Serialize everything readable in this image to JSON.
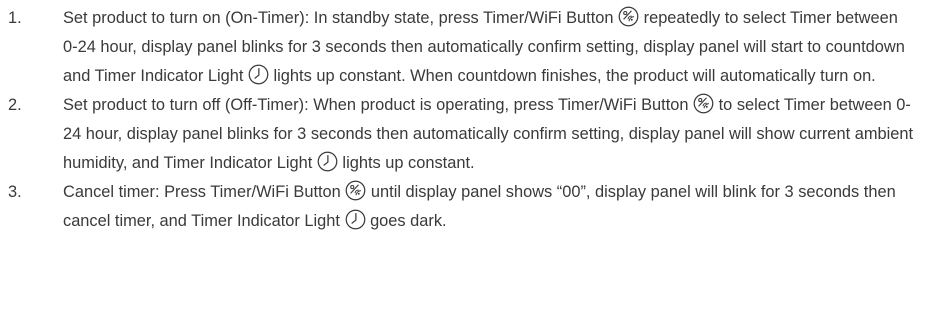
{
  "items": [
    {
      "number": "1.",
      "segments": [
        {
          "type": "text",
          "value": "Set product to turn on (On-Timer): In standby state, press Timer/WiFi Button "
        },
        {
          "type": "icon",
          "icon": "timer-wifi-button-icon"
        },
        {
          "type": "text",
          "value": " repeatedly to select Timer between 0-24 hour, display panel blinks for 3 seconds then automatically confirm setting, display panel will start to countdown and Timer Indicator Light "
        },
        {
          "type": "icon",
          "icon": "timer-indicator-light-icon"
        },
        {
          "type": "text",
          "value": " lights up constant. When countdown finishes, the product will automatically turn on."
        }
      ]
    },
    {
      "number": "2.",
      "segments": [
        {
          "type": "text",
          "value": "Set product to turn off (Off-Timer): When product is operating, press Timer/WiFi Button "
        },
        {
          "type": "icon",
          "icon": "timer-wifi-button-icon"
        },
        {
          "type": "text",
          "value": " to select Timer between 0-24 hour, display panel blinks for 3 seconds then automatically confirm setting, display panel will show current ambient humidity, and Timer Indicator Light "
        },
        {
          "type": "icon",
          "icon": "timer-indicator-light-icon"
        },
        {
          "type": "text",
          "value": " lights up constant."
        }
      ]
    },
    {
      "number": "3.",
      "segments": [
        {
          "type": "text",
          "value": "Cancel timer: Press Timer/WiFi Button "
        },
        {
          "type": "icon",
          "icon": "timer-wifi-button-icon"
        },
        {
          "type": "text",
          "value": " until display panel shows “00”, display panel will blink for 3 seconds then cancel timer, and Timer Indicator Light "
        },
        {
          "type": "icon",
          "icon": "timer-indicator-light-icon"
        },
        {
          "type": "text",
          "value": " goes dark."
        }
      ]
    }
  ],
  "colors": {
    "text": "#3a3a3a",
    "icon_stroke": "#3a3a3a"
  }
}
